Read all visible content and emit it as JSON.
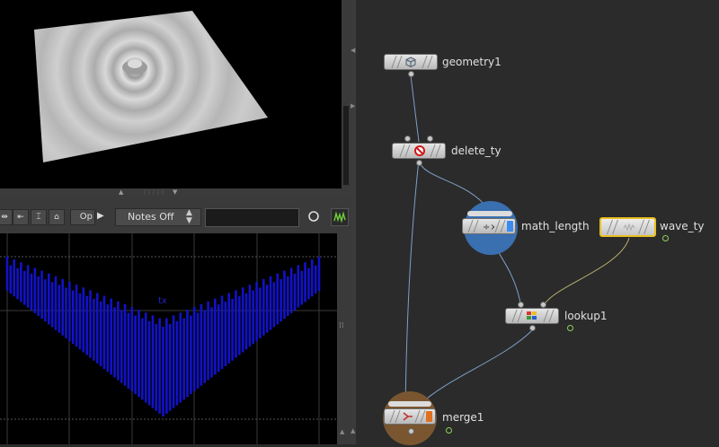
{
  "toolbar": {
    "options_label": "Op",
    "notes_dropdown": "Notes Off",
    "channel_field_value": "",
    "tool_icons": [
      "bounds-icon",
      "range-icon",
      "scale-icon",
      "home-icon"
    ]
  },
  "graph": {
    "channel_label": "tx",
    "series_color": "#1212c8"
  },
  "network": {
    "nodes": [
      {
        "name": "geometry1",
        "icon": "geometry-cube-icon"
      },
      {
        "name": "delete_ty",
        "icon": "delete-icon"
      },
      {
        "name": "math_length",
        "icon": "math-icon",
        "flag_color": "#3c8cf0",
        "selected_ring_color": "#3a6fb0"
      },
      {
        "name": "wave_ty",
        "icon": "wave-icon",
        "outline_color": "#e8c020"
      },
      {
        "name": "lookup1",
        "icon": "lookup-icon"
      },
      {
        "name": "merge1",
        "icon": "merge-icon",
        "flag_color": "#e07020",
        "ring_color": "#7a5630"
      }
    ]
  },
  "colors": {
    "wire": "#7ea0c8",
    "wire_yellow": "#b8b070",
    "display_flag": "#8fcf5a"
  }
}
